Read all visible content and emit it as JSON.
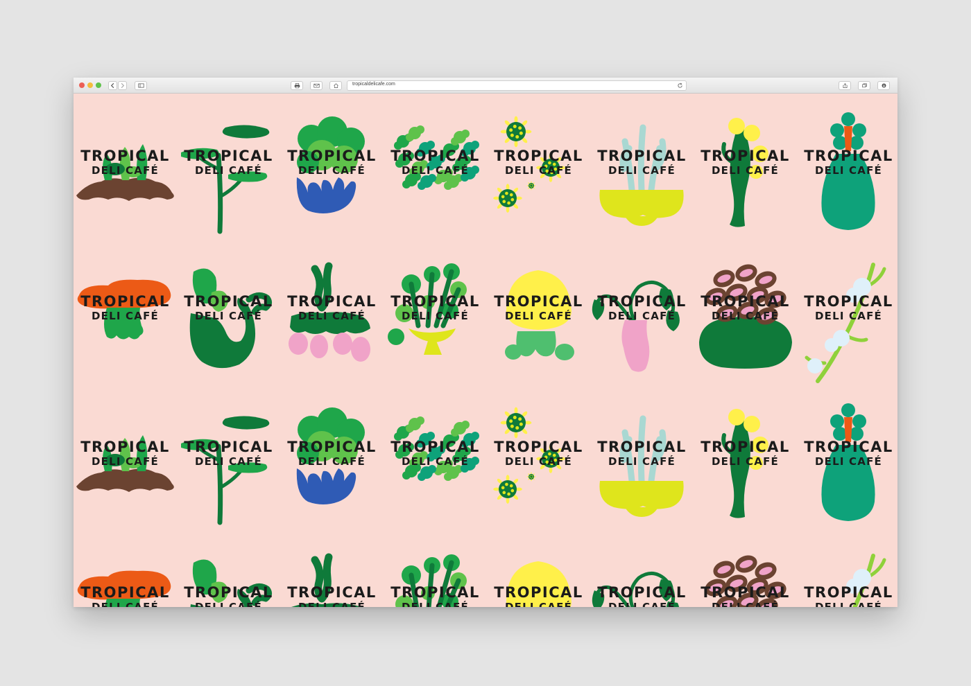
{
  "browser": {
    "url": "tropicaldelicafe.com",
    "traffic_light_colors": [
      "#ec5f56",
      "#f4bd3d",
      "#5fc24b"
    ],
    "icons": [
      "back-icon",
      "forward-icon",
      "sidebar-icon",
      "print-icon",
      "mail-icon",
      "home-icon",
      "reload-icon",
      "share-icon",
      "tabs-icon",
      "download-icon"
    ]
  },
  "wordmark": {
    "line1": "TROPICAL",
    "line2": "DELI CAFÉ"
  },
  "palette": {
    "background": "#fadad3",
    "green_dark": "#0f7a3a",
    "green_mid": "#1fa64a",
    "green_light": "#5fc24b",
    "teal": "#0ea27a",
    "blue": "#2f5bb5",
    "yellow": "#fff04a",
    "lime": "#dfe51c",
    "brown": "#6b4331",
    "orange": "#ec5a16",
    "pink": "#f0a3c8",
    "ice": "#dff0fa",
    "mint": "#a9d8d2"
  },
  "tiles": [
    {
      "id": "sprouts-soil"
    },
    {
      "id": "bonsai-tree"
    },
    {
      "id": "bush-blue-hand"
    },
    {
      "id": "coral-leaves"
    },
    {
      "id": "sun-flowers"
    },
    {
      "id": "cactus-yellow-pot"
    },
    {
      "id": "green-vase-yellow"
    },
    {
      "id": "teal-vase-flower"
    },
    {
      "id": "orange-mushroom"
    },
    {
      "id": "teal-bowl-plant"
    },
    {
      "id": "radish-roots"
    },
    {
      "id": "broccoli-bowl"
    },
    {
      "id": "yellow-bloom"
    },
    {
      "id": "pink-vase-droop"
    },
    {
      "id": "coffee-beans-mound"
    },
    {
      "id": "blossom-branch"
    }
  ]
}
